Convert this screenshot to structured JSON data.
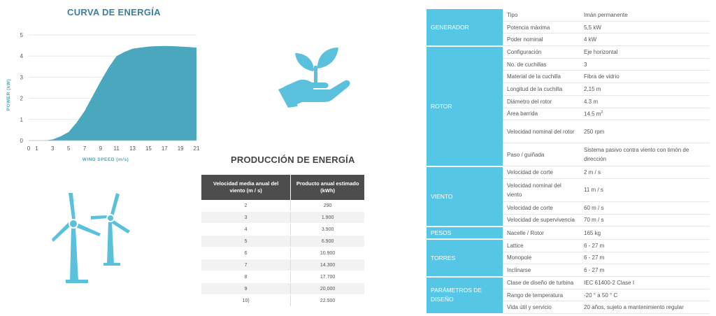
{
  "curve": {
    "title": "CURVA DE ENERGÍA",
    "chart_data": {
      "type": "area",
      "title": "CURVA DE ENERGÍA",
      "xlabel": "WIND SPEED (m/s)",
      "ylabel": "POWER (kW)",
      "xlim": [
        0,
        21
      ],
      "ylim": [
        0,
        5
      ],
      "x_ticks": [
        "0",
        "1",
        "3",
        "5",
        "7",
        "9",
        "11",
        "13",
        "15",
        "17",
        "19",
        "21"
      ],
      "y_ticks": [
        "0",
        "1",
        "2",
        "3",
        "4",
        "5"
      ],
      "grid": true,
      "x": [
        0,
        1,
        2,
        3,
        4,
        5,
        6,
        7,
        8,
        9,
        10,
        11,
        12,
        13,
        14,
        15,
        16,
        17,
        18,
        19,
        20,
        21
      ],
      "values": [
        0,
        0,
        0,
        0.05,
        0.2,
        0.4,
        0.85,
        1.4,
        2.1,
        2.8,
        3.45,
        4.0,
        4.2,
        4.35,
        4.4,
        4.45,
        4.47,
        4.48,
        4.47,
        4.45,
        4.43,
        4.4
      ],
      "color": "#4aa7bd"
    }
  },
  "production": {
    "title": "PRODUCCIÓN DE ENERGÍA",
    "headers": [
      "Velocidad media anual del viento (m / s)",
      "Producto anual estimado (kWh)"
    ],
    "rows": [
      [
        "2",
        "290"
      ],
      [
        "3",
        "1.900"
      ],
      [
        "4",
        "3.900"
      ],
      [
        "5",
        "6.900"
      ],
      [
        "6",
        "10.900"
      ],
      [
        "7",
        "14.300"
      ],
      [
        "8",
        "17.700"
      ],
      [
        "9",
        "20,000"
      ],
      [
        "10)",
        "22.500"
      ]
    ]
  },
  "specs": {
    "generador": "GENERADOR",
    "rotor": "ROTOR",
    "viento": "VIENTO",
    "pesos": "PESOS",
    "torres": "TORRES",
    "parametros": "PARÁMETROS DE DISEÑO",
    "rows": [
      [
        "Tipo",
        "Imán permanente"
      ],
      [
        "Potencia máxima",
        "5,5 kW"
      ],
      [
        "Poder nominal",
        "4 kW"
      ],
      [
        "Configuración",
        "Eje horizontal"
      ],
      [
        "No. de cuchillas",
        "3"
      ],
      [
        "Material de la cuchilla",
        "Fibra de vidrio"
      ],
      [
        "Longitud de la cuchilla",
        "2,15 m"
      ],
      [
        "Diámetro del rotor",
        "4.3 m"
      ],
      [
        "Área barrida",
        "14,5 m"
      ],
      [
        "Velocidad nominal del rotor",
        "250 rpm"
      ],
      [
        "Paso / guiñada",
        "Sistema pasivo contra viento con timón de dirección"
      ],
      [
        "Velocidad de corte",
        "2 m / s"
      ],
      [
        "Velocidad nominal del viento",
        "11 m / s"
      ],
      [
        "Velocidad de corte",
        "60 m / s"
      ],
      [
        "Velocidad de supervivencia",
        "70 m / s"
      ],
      [
        "Nacelle / Rotor",
        "165 kg"
      ],
      [
        "Lattice",
        "6 - 27 m"
      ],
      [
        "Monopole",
        "6 - 27 m"
      ],
      [
        "Inclinarse",
        "6 - 27 m"
      ],
      [
        "Clase de diseño de turbina",
        "IEC 61400-2 Clase I"
      ],
      [
        "Rango de temperatura",
        "-20 ° a 50 ° C"
      ],
      [
        "Vida útil y servicio",
        "20 años, sujeto a mantenimiento regular"
      ]
    ],
    "area_sup": "2"
  },
  "colors": {
    "accent": "#55c6e6",
    "chart": "#4aa7bd",
    "icon": "#5bc0dc",
    "header_dark": "#4d4d4d"
  },
  "icons": {
    "plant": "plant-in-hand-icon",
    "turbines": "wind-turbines-icon"
  }
}
